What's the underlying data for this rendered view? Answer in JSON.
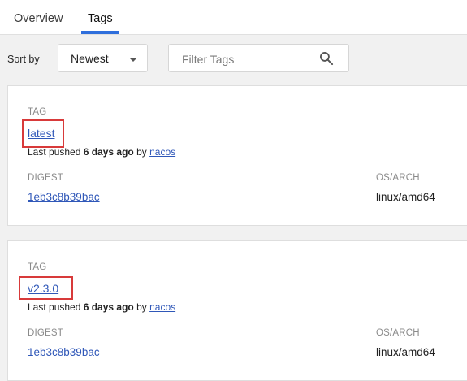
{
  "tabs": [
    {
      "label": "Overview"
    },
    {
      "label": "Tags"
    }
  ],
  "toolbar": {
    "sort_label": "Sort by",
    "sort_value": "Newest",
    "filter_placeholder": "Filter Tags"
  },
  "tags": [
    {
      "tag_label": "TAG",
      "name": "latest",
      "pushed_prefix": "Last pushed ",
      "pushed_when": "6 days ago",
      "pushed_by_text": " by ",
      "pushed_user": "nacos",
      "digest_label": "DIGEST",
      "digest": "1eb3c8b39bac",
      "os_label": "OS/ARCH",
      "os_arch": "linux/amd64"
    },
    {
      "tag_label": "TAG",
      "name": "v2.3.0",
      "pushed_prefix": "Last pushed ",
      "pushed_when": "6 days ago",
      "pushed_by_text": " by ",
      "pushed_user": "nacos",
      "digest_label": "DIGEST",
      "digest": "1eb3c8b39bac",
      "os_label": "OS/ARCH",
      "os_arch": "linux/amd64"
    }
  ],
  "colors": {
    "accent": "#2f6fdc",
    "link": "#2f57b8",
    "highlight": "#d83a3a"
  }
}
